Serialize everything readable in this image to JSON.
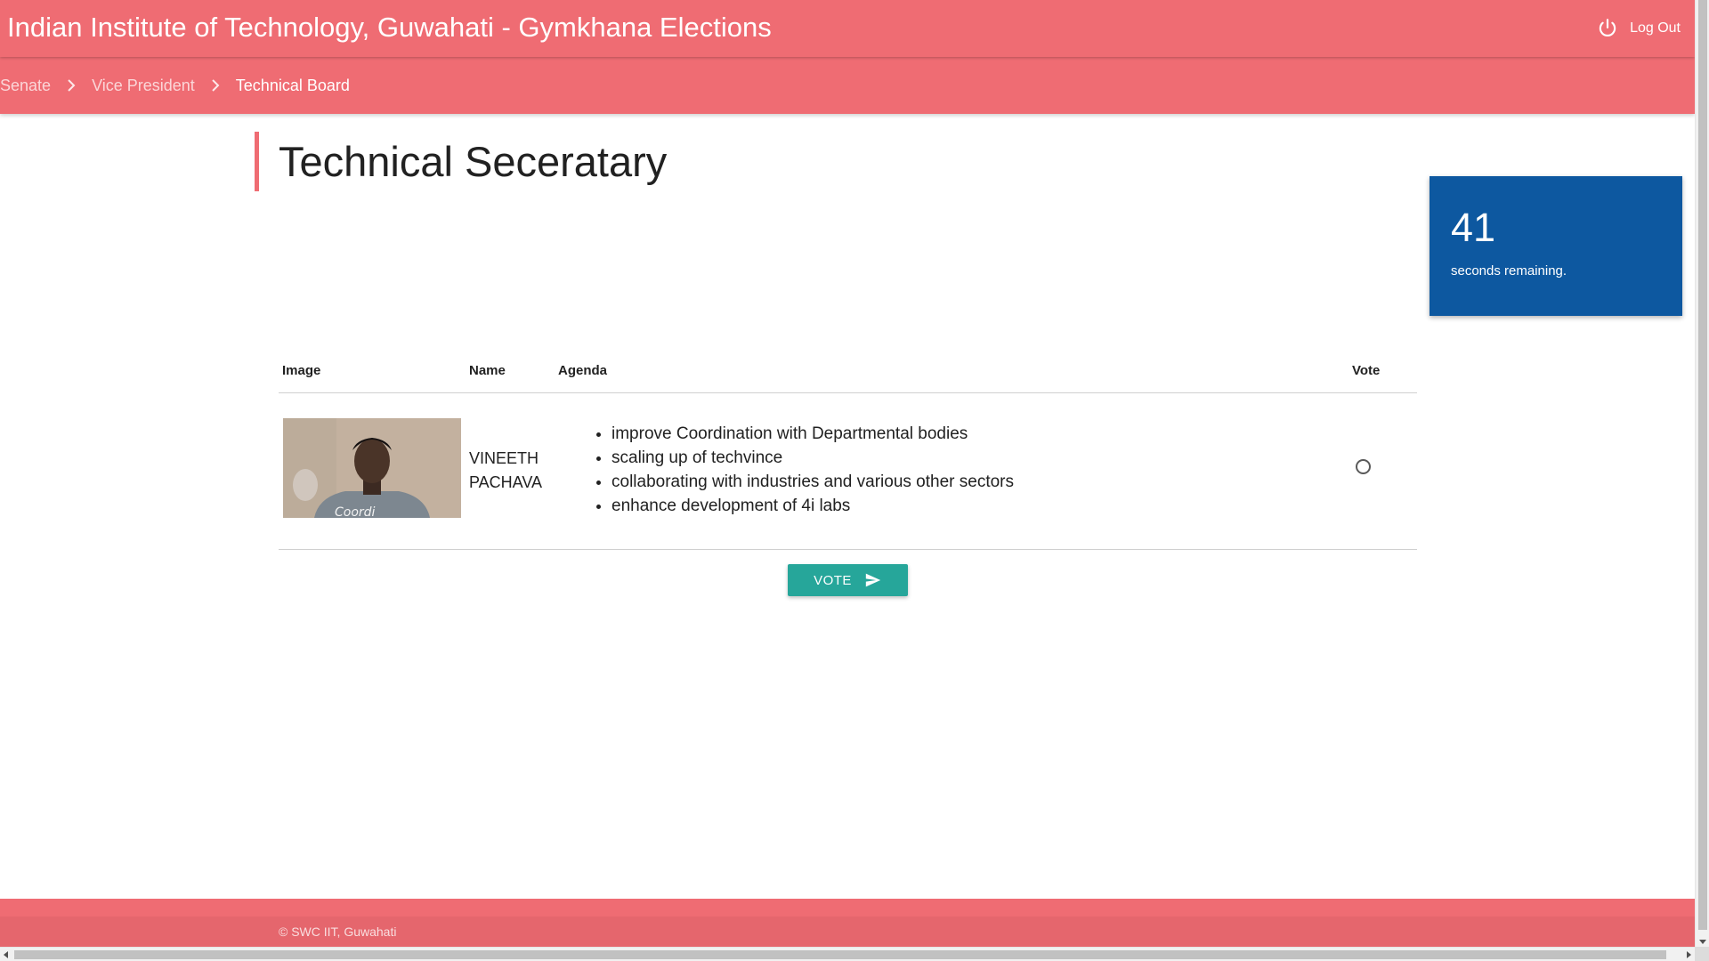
{
  "header": {
    "title": "Indian Institute of Technology, Guwahati - Gymkhana Elections",
    "logout_label": "Log Out",
    "logout_icon": "power-icon"
  },
  "breadcrumb": {
    "items": [
      {
        "label": "Senate",
        "active": false
      },
      {
        "label": "Vice President",
        "active": false
      },
      {
        "label": "Technical Board",
        "active": true
      }
    ],
    "separator_icon": "chevron-right-icon"
  },
  "main": {
    "title": "Technical Seceratary",
    "table": {
      "columns": [
        "Image",
        "Name",
        "Agenda",
        "Vote"
      ],
      "rows": [
        {
          "name": "VINEETH PACHAVA",
          "image": "candidate-photo",
          "agenda": [
            "improve Coordination with Departmental bodies",
            "scaling up of techvince",
            "collaborating with industries and various other sectors",
            "enhance development of 4i labs"
          ],
          "selected": false
        }
      ]
    },
    "vote_button": {
      "label": "VOTE",
      "icon": "send-icon"
    }
  },
  "timer": {
    "seconds": "41",
    "label": "seconds remaining."
  },
  "footer": {
    "copyright": "© SWC IIT, Guwahati"
  },
  "colors": {
    "primary": "#ef6c73",
    "timer_bg": "#0d58a0",
    "button": "#26a69a"
  }
}
